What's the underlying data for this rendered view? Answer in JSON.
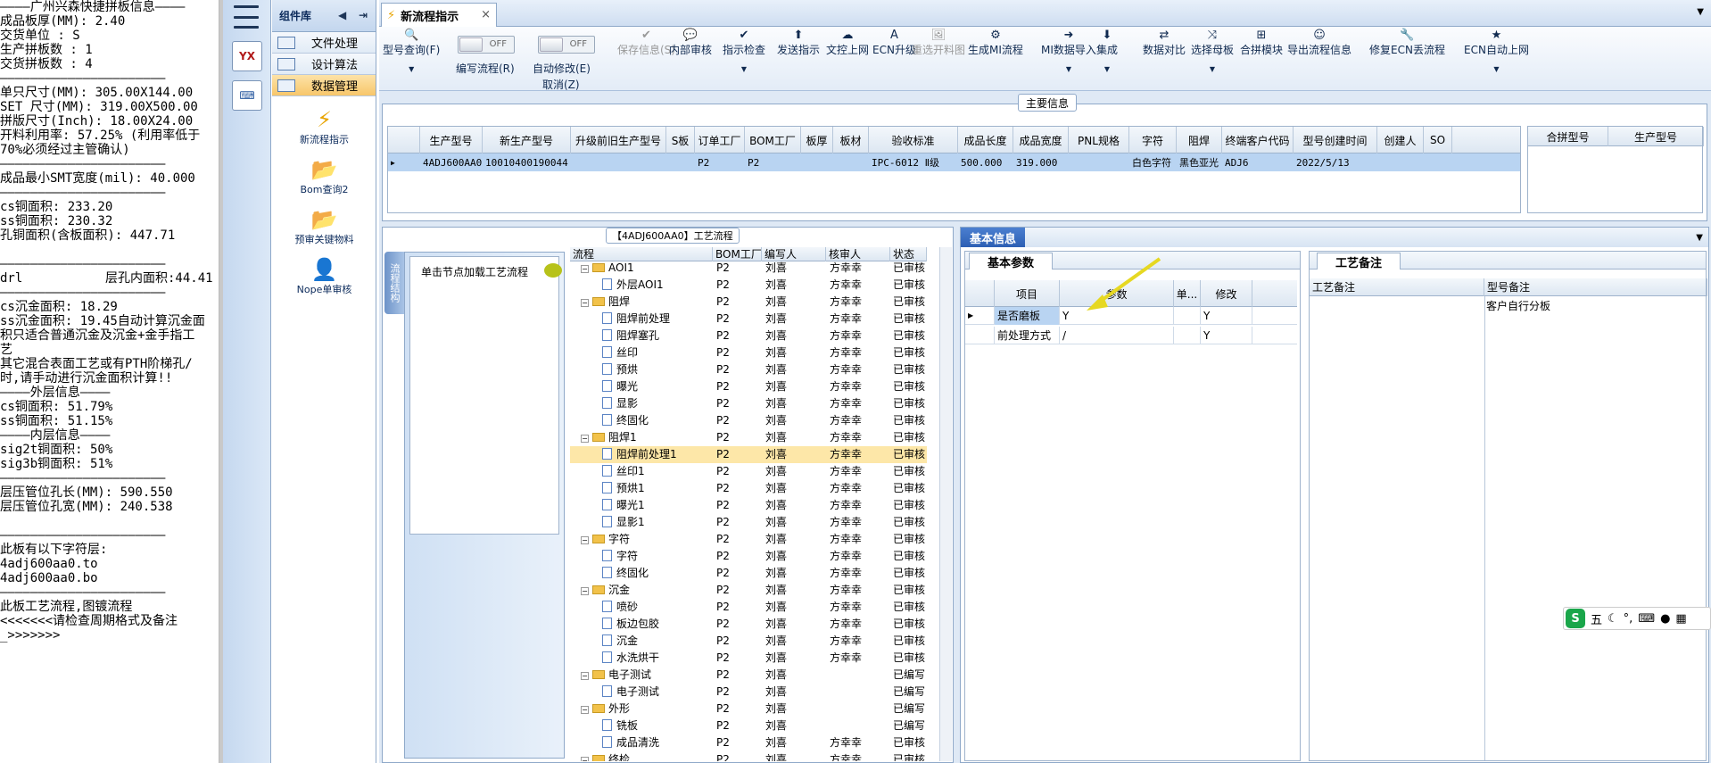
{
  "left_log": [
    "————广州兴森快捷拼板信息————",
    "成品板厚(MM): 2.40",
    "交货单位 : S",
    "生产拼板数 : 1",
    "交货拼板数 : 4",
    "——————————————————————",
    "单只尺寸(MM): 305.00X144.00",
    "SET 尺寸(MM): 319.00X500.00",
    "拼版尺寸(Inch): 18.00X24.00",
    "开料利用率: 57.25% (利用率低于",
    "70%必须经过主管确认)",
    "——————————————————————",
    "成品最小SMT宽度(mil): 40.000",
    "——————————————————————",
    "cs铜面积: 233.20",
    "ss铜面积: 230.32",
    "孔铜面积(含板面积): 447.71",
    "",
    "——————————————————————",
    "drl           层孔内面积:44.41",
    "——————————————————————",
    "cs沉金面积: 18.29",
    "ss沉金面积: 19.45自动计算沉金面",
    "积只适合普通沉金及沉金+金手指工",
    "艺",
    "其它混合表面工艺或有PTH阶梯孔/",
    "时,请手动进行沉金面积计算!!",
    "————外层信息————",
    "cs铜面积: 51.79%",
    "ss铜面积: 51.15%",
    "————内层信息————",
    "sig2t铜面积: 50%",
    "sig3b铜面积: 51%",
    "——————————————————————",
    "层压管位孔长(MM): 590.550",
    "层压管位孔宽(MM): 240.538",
    "",
    "——————————————————————",
    "此板有以下字符层:",
    "4adj600aa0.to",
    "4adj600aa0.bo",
    "——————————————————————",
    "此板工艺流程,图镀流程",
    "<<<<<<<请检查周期格式及备注",
    "_>>>>>>>"
  ],
  "iconbar": {
    "logo_text": "YX"
  },
  "complib": {
    "title": "组件库",
    "categories": [
      "文件处理",
      "设计算法",
      "数据管理"
    ],
    "tools": [
      "新流程指示",
      "Bom查询2",
      "预审关键物料",
      "Nope单审核"
    ]
  },
  "tab": {
    "title": "新流程指示",
    "close": "×"
  },
  "toolbar": {
    "buttons": [
      "型号查询(F)",
      "保存信息(S)",
      "内部审核",
      "指示检查",
      "发送指示",
      "文控上网",
      "ECN升级",
      "重选开料图",
      "生成MI流程",
      "MI数据导入",
      "集成",
      "数据对比",
      "选择母板",
      "合拼模块",
      "导出流程信息",
      "修复ECN丢流程",
      "ECN自动上网"
    ],
    "toggle_off": "OFF",
    "write_flow": "编写流程(R)",
    "auto_modify": "自动修改(E)",
    "cancel": "取消(Z)"
  },
  "main_info": {
    "title": "主要信息",
    "headers": [
      "生产型号",
      "新生产型号",
      "升级前旧生产型号",
      "S板",
      "订单工厂",
      "BOM工厂",
      "板厚",
      "板材",
      "验收标准",
      "成品长度",
      "成品宽度",
      "PNL规格",
      "字符",
      "阻焊",
      "终端客户代码",
      "型号创建时间",
      "创建人",
      "SO"
    ],
    "row": [
      "4ADJ600AA0",
      "10010400190044",
      "",
      "",
      "P2",
      "P2",
      "",
      "",
      "IPC-6012 Ⅱ级",
      "500.000",
      "319.000",
      "",
      "白色字符",
      "黑色亚光",
      "ADJ6",
      "2022/5/13",
      "",
      ""
    ],
    "side_headers": [
      "合拼型号",
      "生产型号"
    ]
  },
  "process": {
    "title": "【4ADJ600AA0】工艺流程",
    "vtab": "流程结构",
    "node_hint": "单击节点加载工艺流程",
    "headers": [
      "流程",
      "BOM工厂",
      "编写人",
      "核审人",
      "状态"
    ],
    "rows": [
      {
        "name": "AOI1",
        "level": 0,
        "bom": "P2",
        "writer": "刘喜",
        "reviewer": "方幸幸",
        "status": "已审核"
      },
      {
        "name": "外层AOI1",
        "level": 1,
        "bom": "P2",
        "writer": "刘喜",
        "reviewer": "方幸幸",
        "status": "已审核"
      },
      {
        "name": "阻焊",
        "level": 0,
        "bom": "P2",
        "writer": "刘喜",
        "reviewer": "方幸幸",
        "status": "已审核"
      },
      {
        "name": "阻焊前处理",
        "level": 1,
        "bom": "P2",
        "writer": "刘喜",
        "reviewer": "方幸幸",
        "status": "已审核"
      },
      {
        "name": "阻焊塞孔",
        "level": 1,
        "bom": "P2",
        "writer": "刘喜",
        "reviewer": "方幸幸",
        "status": "已审核"
      },
      {
        "name": "丝印",
        "level": 1,
        "bom": "P2",
        "writer": "刘喜",
        "reviewer": "方幸幸",
        "status": "已审核"
      },
      {
        "name": "预烘",
        "level": 1,
        "bom": "P2",
        "writer": "刘喜",
        "reviewer": "方幸幸",
        "status": "已审核"
      },
      {
        "name": "曝光",
        "level": 1,
        "bom": "P2",
        "writer": "刘喜",
        "reviewer": "方幸幸",
        "status": "已审核"
      },
      {
        "name": "显影",
        "level": 1,
        "bom": "P2",
        "writer": "刘喜",
        "reviewer": "方幸幸",
        "status": "已审核"
      },
      {
        "name": "终固化",
        "level": 1,
        "bom": "P2",
        "writer": "刘喜",
        "reviewer": "方幸幸",
        "status": "已审核"
      },
      {
        "name": "阻焊1",
        "level": 0,
        "bom": "P2",
        "writer": "刘喜",
        "reviewer": "方幸幸",
        "status": "已审核"
      },
      {
        "name": "阻焊前处理1",
        "level": 1,
        "bom": "P2",
        "writer": "刘喜",
        "reviewer": "方幸幸",
        "status": "已审核",
        "selected": true
      },
      {
        "name": "丝印1",
        "level": 1,
        "bom": "P2",
        "writer": "刘喜",
        "reviewer": "方幸幸",
        "status": "已审核"
      },
      {
        "name": "预烘1",
        "level": 1,
        "bom": "P2",
        "writer": "刘喜",
        "reviewer": "方幸幸",
        "status": "已审核"
      },
      {
        "name": "曝光1",
        "level": 1,
        "bom": "P2",
        "writer": "刘喜",
        "reviewer": "方幸幸",
        "status": "已审核"
      },
      {
        "name": "显影1",
        "level": 1,
        "bom": "P2",
        "writer": "刘喜",
        "reviewer": "方幸幸",
        "status": "已审核"
      },
      {
        "name": "字符",
        "level": 0,
        "bom": "P2",
        "writer": "刘喜",
        "reviewer": "方幸幸",
        "status": "已审核"
      },
      {
        "name": "字符",
        "level": 1,
        "bom": "P2",
        "writer": "刘喜",
        "reviewer": "方幸幸",
        "status": "已审核"
      },
      {
        "name": "终固化",
        "level": 1,
        "bom": "P2",
        "writer": "刘喜",
        "reviewer": "方幸幸",
        "status": "已审核"
      },
      {
        "name": "沉金",
        "level": 0,
        "bom": "P2",
        "writer": "刘喜",
        "reviewer": "方幸幸",
        "status": "已审核"
      },
      {
        "name": "喷砂",
        "level": 1,
        "bom": "P2",
        "writer": "刘喜",
        "reviewer": "方幸幸",
        "status": "已审核"
      },
      {
        "name": "板边包胶",
        "level": 1,
        "bom": "P2",
        "writer": "刘喜",
        "reviewer": "方幸幸",
        "status": "已审核"
      },
      {
        "name": "沉金",
        "level": 1,
        "bom": "P2",
        "writer": "刘喜",
        "reviewer": "方幸幸",
        "status": "已审核"
      },
      {
        "name": "水洗烘干",
        "level": 1,
        "bom": "P2",
        "writer": "刘喜",
        "reviewer": "方幸幸",
        "status": "已审核"
      },
      {
        "name": "电子测试",
        "level": 0,
        "bom": "P2",
        "writer": "刘喜",
        "reviewer": "",
        "status": "已编写"
      },
      {
        "name": "电子测试",
        "level": 1,
        "bom": "P2",
        "writer": "刘喜",
        "reviewer": "",
        "status": "已编写"
      },
      {
        "name": "外形",
        "level": 0,
        "bom": "P2",
        "writer": "刘喜",
        "reviewer": "",
        "status": "已编写"
      },
      {
        "name": "铣板",
        "level": 1,
        "bom": "P2",
        "writer": "刘喜",
        "reviewer": "",
        "status": "已编写"
      },
      {
        "name": "成品清洗",
        "level": 1,
        "bom": "P2",
        "writer": "刘喜",
        "reviewer": "方幸幸",
        "status": "已审核"
      },
      {
        "name": "终检",
        "level": 0,
        "bom": "P2",
        "writer": "刘喜",
        "reviewer": "方幸幸",
        "status": "已审核"
      }
    ]
  },
  "basic_info": {
    "title": "基本信息",
    "params_tab": "基本参数",
    "headers": [
      "项目",
      "参数",
      "单...",
      "修改"
    ],
    "rows": [
      {
        "item": "是否磨板",
        "param": "Y",
        "unit": "",
        "modify": "Y"
      },
      {
        "item": "前处理方式",
        "param": "/",
        "unit": "",
        "modify": "Y"
      }
    ]
  },
  "process_memo": {
    "tab": "工艺备注",
    "headers": [
      "工艺备注",
      "型号备注"
    ],
    "value": "客户自行分板"
  },
  "ime": {
    "logo": "S",
    "mode": "五"
  }
}
